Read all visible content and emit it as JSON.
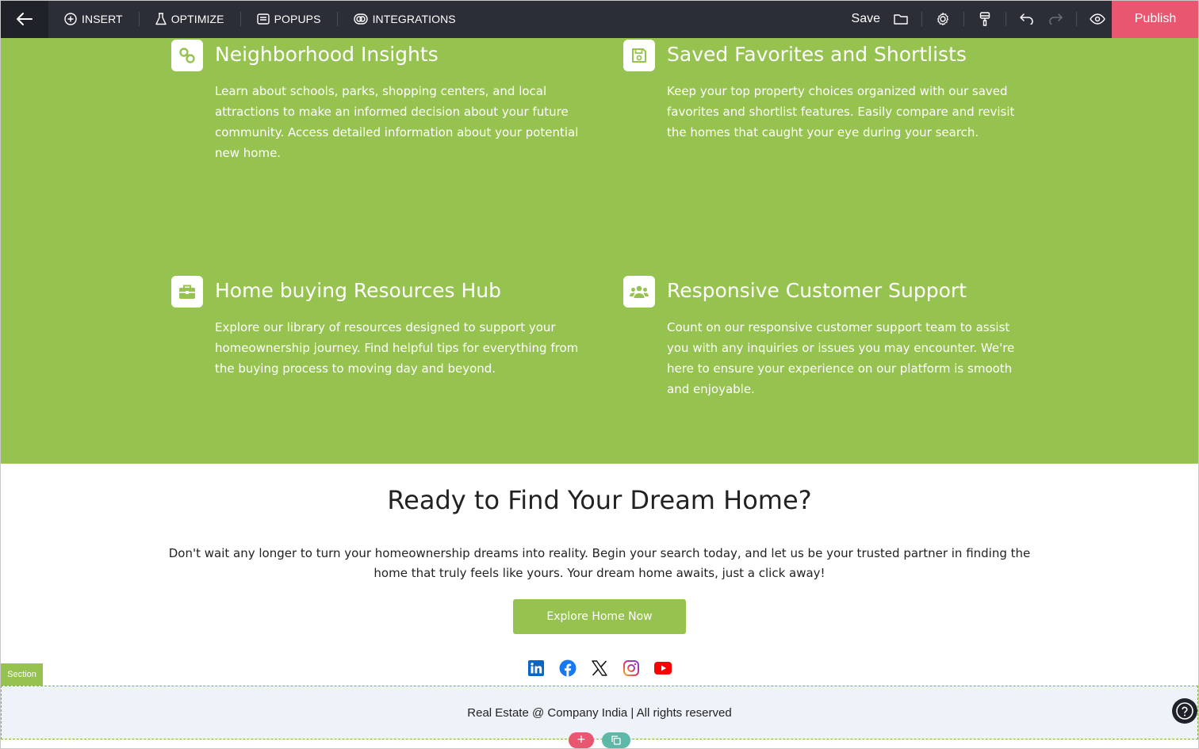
{
  "toolbar": {
    "menu": [
      {
        "label": "INSERT",
        "icon": "plus-circle-icon"
      },
      {
        "label": "OPTIMIZE",
        "icon": "flask-icon"
      },
      {
        "label": "POPUPS",
        "icon": "popup-icon"
      },
      {
        "label": "INTEGRATIONS",
        "icon": "integrations-icon"
      }
    ],
    "save_label": "Save",
    "publish_label": "Publish"
  },
  "features": [
    {
      "icon": "link-icon",
      "title": "Neighborhood Insights",
      "text": "Learn about schools, parks, shopping centers, and local attractions to make an informed decision about your future community. Access detailed information about your potential new home."
    },
    {
      "icon": "floppy-disk-icon",
      "title": "Saved Favorites and Shortlists",
      "text": "Keep your top property choices organized with our saved favorites and shortlist features. Easily compare and revisit the homes that caught your eye during your search."
    },
    {
      "icon": "briefcase-icon",
      "title": "Home buying Resources Hub",
      "text": "Explore our library of resources designed to support your homeownership journey. Find helpful tips for everything from the buying process to moving day and beyond."
    },
    {
      "icon": "users-icon",
      "title": "Responsive Customer Support",
      "text": "Count on our responsive customer support team to assist you with any inquiries or issues you may encounter. We're here to ensure your experience on our platform is smooth and enjoyable."
    }
  ],
  "cta": {
    "title": "Ready to Find Your Dream Home?",
    "text": "Don't wait any longer to turn your homeownership dreams into reality. Begin your search today, and let us be your trusted partner in finding the home that truly feels like yours. Your dream home awaits, just a click away!",
    "button_label": "Explore Home Now"
  },
  "socials": [
    "linkedin-icon",
    "facebook-icon",
    "x-icon",
    "instagram-icon",
    "youtube-icon"
  ],
  "section_tag": "Section",
  "footer": {
    "text": "Real Estate @ Company India | All rights reserved"
  },
  "colors": {
    "accent": "#96c24f",
    "publish": "#e8566f",
    "toolbar": "#2b2e36"
  }
}
